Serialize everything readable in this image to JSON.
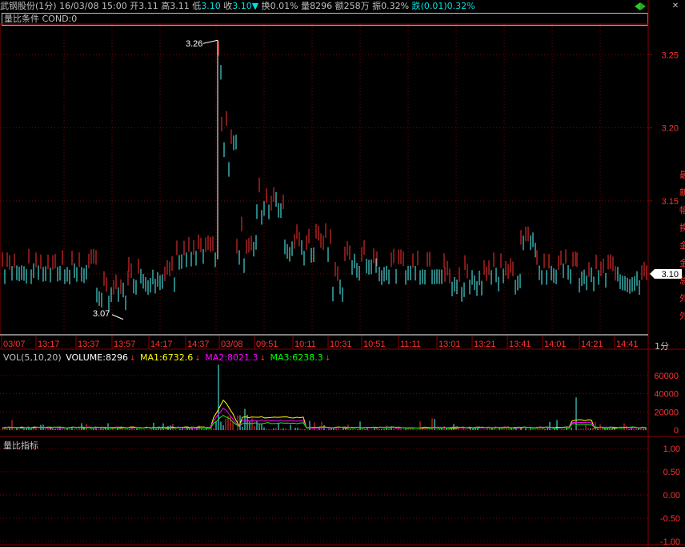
{
  "header": {
    "name": "武钢股份",
    "period": "(1分)",
    "datetime": "16/03/08 15:00",
    "open_label": "开",
    "open_value": "3.11",
    "high_label": "高",
    "high_value": "3.11",
    "low_label": "低",
    "low_value": "3.10",
    "close_label": "收",
    "close_value": "3.10",
    "turnover_label": "换",
    "turnover_value": "0.01%",
    "volume_label": "量",
    "volume_value": "8296",
    "amount_label": "额",
    "amount_value": "258万",
    "amplitude_label": "振",
    "amplitude_value": "0.32%",
    "change_label": "跌",
    "change_value": "(0.01)0.32%"
  },
  "condition_bar": {
    "text": "量比条件 COND:0"
  },
  "price_panel": {
    "y_ticks": [
      "3.25",
      "3.20",
      "3.15",
      "3.10"
    ],
    "current_price_tag": "3.10",
    "high_annotation": "3.26",
    "low_annotation": "3.07",
    "right_side_chars": [
      "最",
      "新",
      "幅",
      "换",
      "金",
      "金",
      "总",
      "外",
      "外"
    ]
  },
  "time_axis": {
    "labels": [
      "03/07",
      "13:17",
      "13:37",
      "13:57",
      "14:17",
      "14:37",
      "03/08",
      "09:51",
      "10:11",
      "10:31",
      "10:51",
      "11:11",
      "13:01",
      "13:21",
      "13:41",
      "14:01",
      "14:21",
      "14:41"
    ],
    "period_label": "1分"
  },
  "volume_panel": {
    "legend": {
      "title": "VOL(5,10,20)",
      "volume": "VOLUME:8296",
      "ma1": "MA1:6732.6",
      "ma2": "MA2:8021.3",
      "ma3": "MA3:6238.3"
    },
    "y_ticks": [
      "60000",
      "40000",
      "20000",
      "0"
    ]
  },
  "indicator_panel": {
    "title": "量比指标",
    "y_ticks": [
      "1.00",
      "0.50",
      "0.00",
      "-0.50",
      "-1.00"
    ]
  },
  "colors": {
    "up": "#ff3232",
    "down": "#54ffff",
    "grid": "#8b0000",
    "axis_text": "#ff3232",
    "ma1": "#ffff00",
    "ma2": "#ff00ff",
    "ma3": "#00ff00",
    "white": "#ffffff",
    "header_cyan": "#00e0e0"
  },
  "chart_data": {
    "type": "candlestick",
    "price_range": [
      3.06,
      3.27
    ],
    "price_high": 3.26,
    "price_low": 3.07,
    "last_price": 3.1,
    "volume_range": [
      0,
      75000
    ],
    "indicator_range": [
      -1.0,
      1.0
    ]
  }
}
